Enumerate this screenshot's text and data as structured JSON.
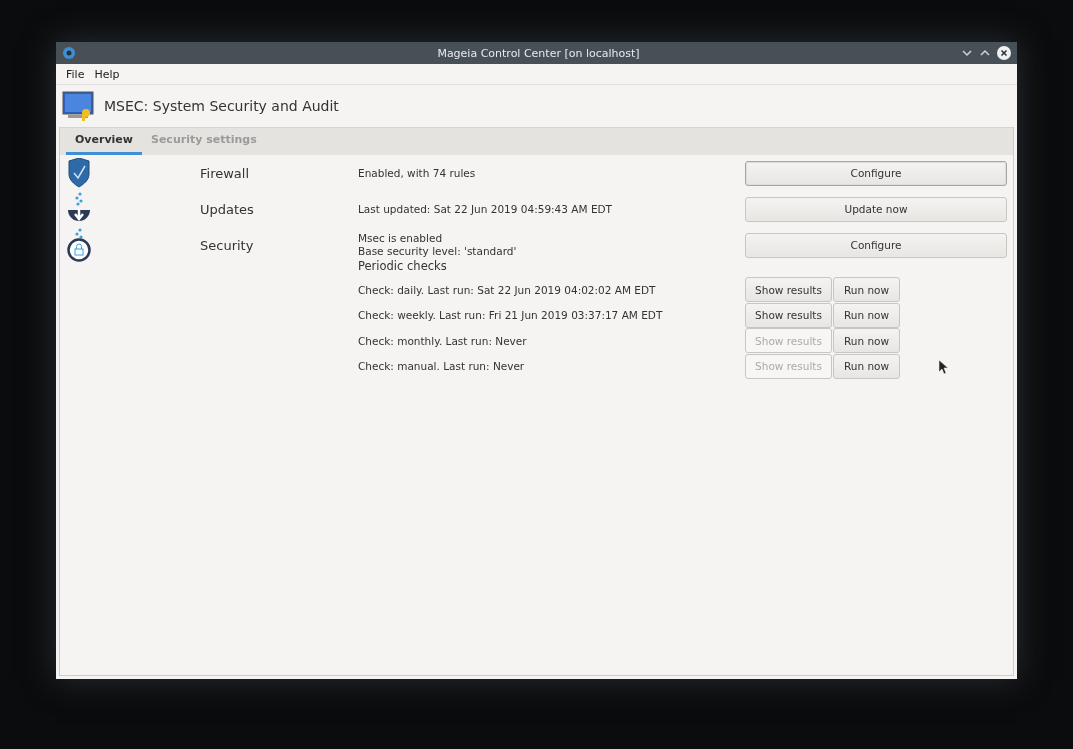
{
  "window": {
    "title": "Mageia Control Center [on localhost]"
  },
  "menu": [
    {
      "label": "File"
    },
    {
      "label": "Help"
    }
  ],
  "header": {
    "title": "MSEC: System Security and Audit"
  },
  "tabs": [
    {
      "label": "Overview",
      "selected": true
    },
    {
      "label": "Security settings",
      "selected": false
    }
  ],
  "sections": [
    {
      "kind": "firewall",
      "name": "Firewall",
      "lines": [
        "Enabled, with 74 rules"
      ],
      "button": {
        "label": "Configure",
        "focused": true
      }
    },
    {
      "kind": "updates",
      "name": "Updates",
      "lines": [
        "Last updated: Sat 22 Jun 2019 04:59:43 AM EDT"
      ],
      "button": {
        "label": "Update now",
        "focused": false
      }
    },
    {
      "kind": "security",
      "name": "Security",
      "lines": [
        "Msec is enabled",
        "Base security level: 'standard'"
      ],
      "button": {
        "label": "Configure",
        "focused": false
      }
    }
  ],
  "periodic": {
    "title": "Periodic checks",
    "checks": [
      {
        "label": "Check: daily. Last run: Sat 22 Jun 2019 04:02:02 AM EDT",
        "show": {
          "label": "Show results",
          "disabled": false
        },
        "run": {
          "label": "Run now"
        }
      },
      {
        "label": "Check: weekly. Last run: Fri 21 Jun 2019 03:37:17 AM EDT",
        "show": {
          "label": "Show results",
          "disabled": false
        },
        "run": {
          "label": "Run now"
        }
      },
      {
        "label": "Check: monthly. Last run: Never",
        "show": {
          "label": "Show results",
          "disabled": true
        },
        "run": {
          "label": "Run now"
        }
      },
      {
        "label": "Check: manual. Last run: Never",
        "show": {
          "label": "Show results",
          "disabled": true
        },
        "run": {
          "label": "Run now"
        }
      }
    ]
  }
}
